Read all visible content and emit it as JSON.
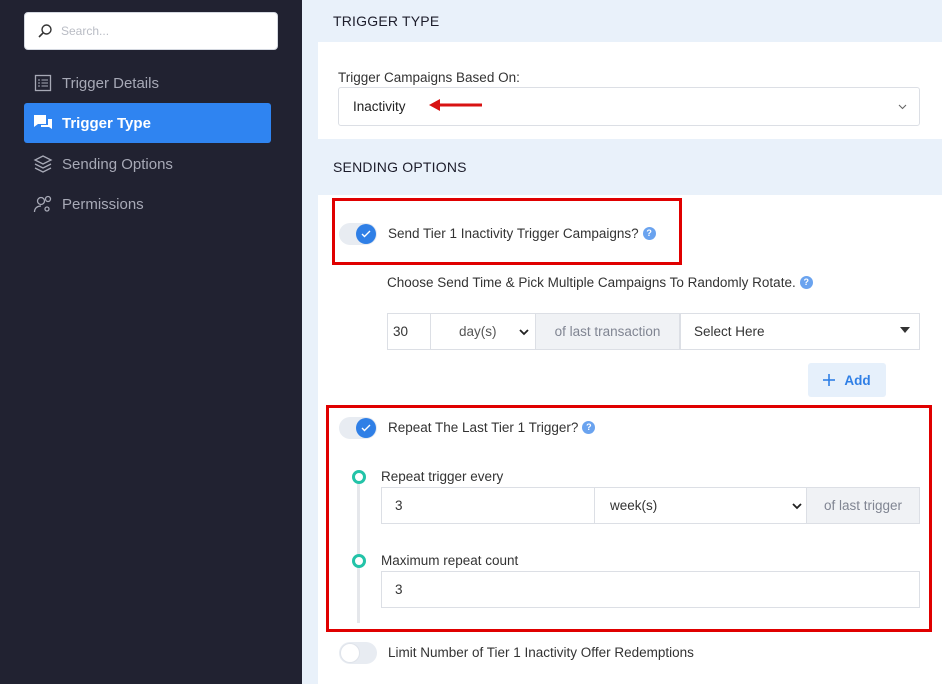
{
  "sidebar": {
    "search_placeholder": "Search...",
    "items": [
      {
        "label": "Trigger Details",
        "icon": "list-icon"
      },
      {
        "label": "Trigger Type",
        "icon": "chat-icon",
        "active": true
      },
      {
        "label": "Sending Options",
        "icon": "layers-icon"
      },
      {
        "label": "Permissions",
        "icon": "user-gear-icon"
      }
    ]
  },
  "trigger_type": {
    "heading": "TRIGGER TYPE",
    "based_on_label": "Trigger Campaigns Based On:",
    "based_on_value": "Inactivity"
  },
  "sending_options": {
    "heading": "SENDING OPTIONS",
    "send_tier1_label": "Send Tier 1 Inactivity Trigger Campaigns?",
    "choose_label": "Choose Send Time & Pick Multiple Campaigns To Randomly Rotate.",
    "time_value": "30",
    "time_unit": "day(s)",
    "time_suffix": "of last transaction",
    "campaign_select": "Select Here",
    "add_label": "Add",
    "repeat_label": "Repeat The Last Tier 1 Trigger?",
    "repeat_every_label": "Repeat trigger every",
    "repeat_every_value": "3",
    "repeat_every_unit": "week(s)",
    "repeat_every_suffix": "of last trigger",
    "max_repeat_label": "Maximum repeat count",
    "max_repeat_value": "3",
    "limit_label": "Limit Number of Tier 1 Inactivity Offer Redemptions"
  },
  "help_glyph": "?",
  "colors": {
    "accent": "#2f84f1",
    "sidebar_bg": "#212231",
    "highlight": "#e00000",
    "timeline": "#23c3a8"
  }
}
